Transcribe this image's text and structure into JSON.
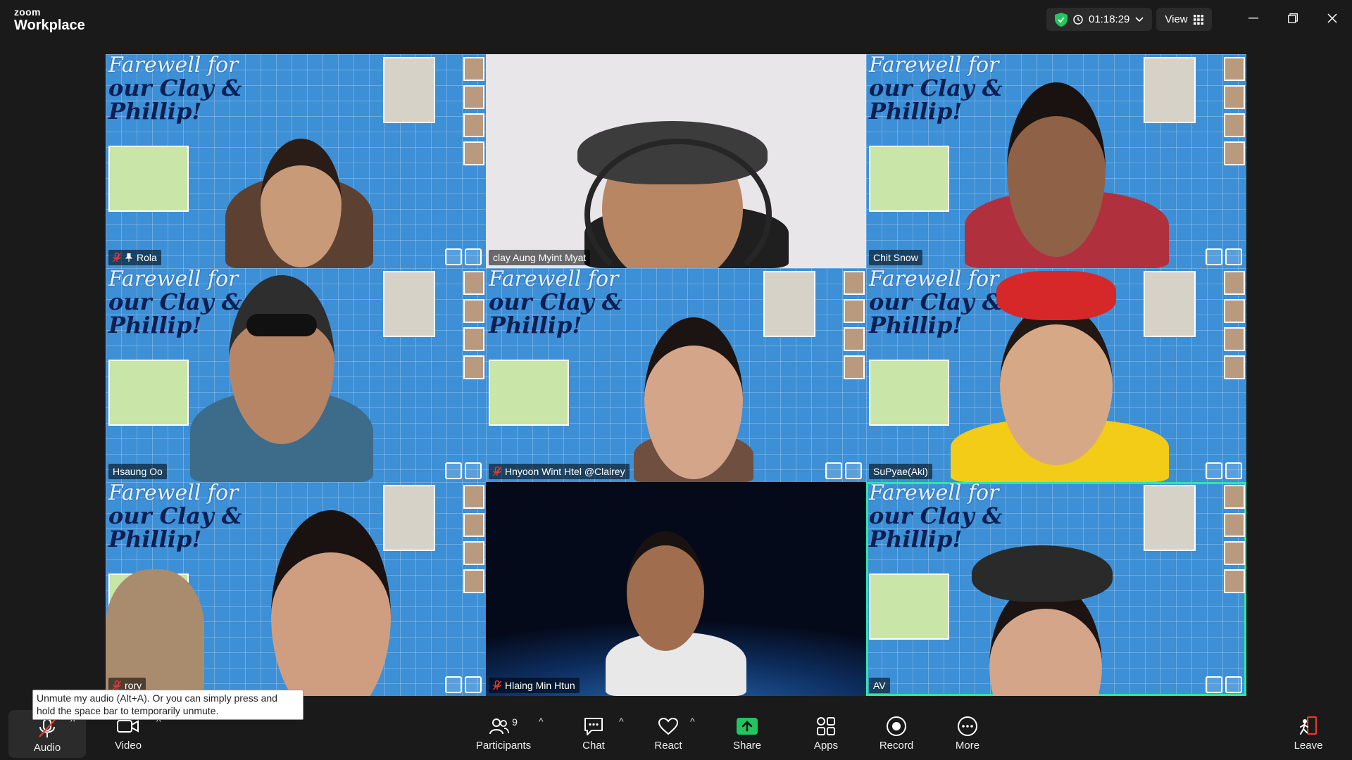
{
  "brand": {
    "line1": "zoom",
    "line2": "Workplace"
  },
  "header": {
    "timer": "01:18:29",
    "view_label": "View",
    "shield_color": "#22c55e"
  },
  "tiles": [
    {
      "name": "Rola",
      "muted": true,
      "pinned": true,
      "background": "farewell"
    },
    {
      "name": "clay Aung Myint Myat",
      "muted": false,
      "pinned": false,
      "background": "plain"
    },
    {
      "name": "Chit Snow",
      "muted": false,
      "pinned": false,
      "background": "farewell"
    },
    {
      "name": "Hsaung Oo",
      "muted": false,
      "pinned": false,
      "background": "farewell"
    },
    {
      "name": "Hnyoon Wint Htel @Clairey",
      "muted": true,
      "pinned": false,
      "background": "farewell"
    },
    {
      "name": "SuPyae(Aki)",
      "muted": false,
      "pinned": false,
      "background": "farewell"
    },
    {
      "name": "rory",
      "muted": true,
      "pinned": false,
      "background": "farewell"
    },
    {
      "name": "Hlaing Min Htun",
      "muted": true,
      "pinned": false,
      "background": "space"
    },
    {
      "name": "AV",
      "muted": false,
      "pinned": false,
      "background": "farewell",
      "active_speaker": true
    }
  ],
  "virtual_background_text": {
    "line1": "Farewell for",
    "line2": "our Clay & Phillip!"
  },
  "toolbar": {
    "audio_label": "Audio",
    "video_label": "Video",
    "participants_label": "Participants",
    "participants_count": "9",
    "chat_label": "Chat",
    "react_label": "React",
    "share_label": "Share",
    "apps_label": "Apps",
    "record_label": "Record",
    "more_label": "More",
    "leave_label": "Leave"
  },
  "tooltip": {
    "text": "Unmute my audio (Alt+A). Or you can simply press and hold the space bar to temporarily unmute."
  },
  "colors": {
    "active_speaker_border": "#2ee6a6",
    "share_green": "#22c55e",
    "leave_red": "#e53935",
    "muted_red": "#e53935"
  }
}
